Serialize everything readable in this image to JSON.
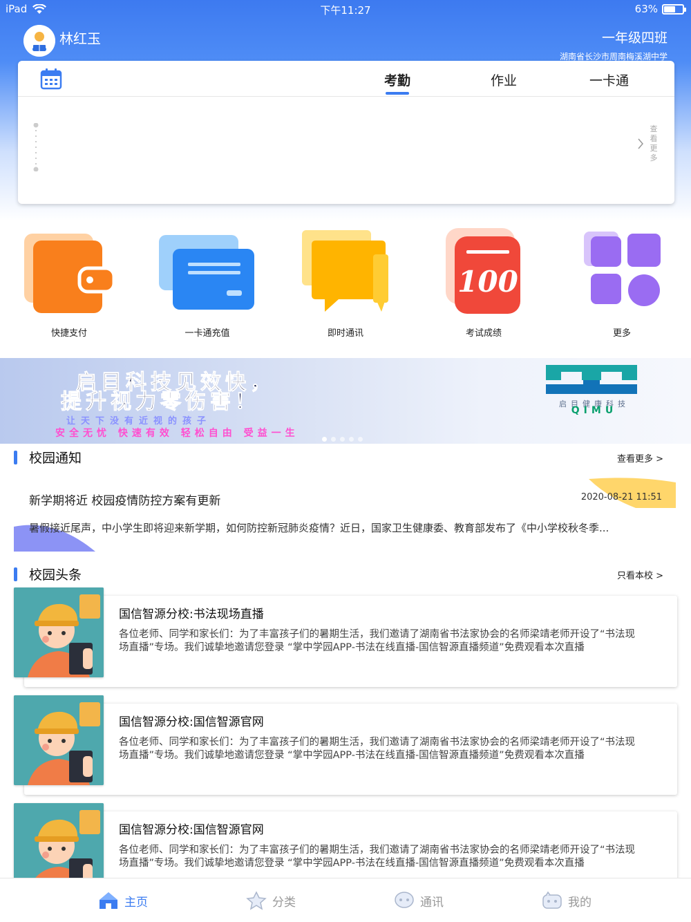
{
  "status_bar": {
    "device": "iPad",
    "time": "下午11:27",
    "battery": "63%",
    "battery_level": 0.63
  },
  "user": {
    "name": "林红玉"
  },
  "class_info": {
    "grade": "一年级四班",
    "school": "湖南省长沙市周南梅溪湖中学"
  },
  "top_tabs": [
    {
      "label": "考勤",
      "active": true
    },
    {
      "label": "作业",
      "active": false
    },
    {
      "label": "一卡通",
      "active": false
    }
  ],
  "attendance": {
    "see_more": "查看更多"
  },
  "quick_icons": [
    {
      "label": "快捷支付",
      "icon": "wallet-icon",
      "color": "#f97f1c"
    },
    {
      "label": "一卡通充值",
      "icon": "card-icon",
      "color": "#2a86f3"
    },
    {
      "label": "即时通讯",
      "icon": "chat-icon",
      "color": "#ffb400"
    },
    {
      "label": "考试成绩",
      "icon": "score-100-icon",
      "color": "#f0483a"
    },
    {
      "label": "更多",
      "icon": "more-grid-icon",
      "color": "#9a6cf2"
    }
  ],
  "banner": {
    "line1": "启目科技见效快，",
    "line2": "提升视力零伤害！",
    "line3": "让天下没有近视的孩子",
    "line4": "安全无忧 快速有效 轻松自由 受益一生",
    "logo_cn": "启目健康科技",
    "logo_en": "QIMU"
  },
  "campus_notice": {
    "title": "校园通知",
    "more": "查看更多 >",
    "item": {
      "title": "新学期将近 校园疫情防控方案有更新",
      "date": "2020-08-21 11:51",
      "body": "暑假接近尾声，中小学生即将迎来新学期，如何防控新冠肺炎疫情？近日，国家卫生健康委、教育部发布了《中小学校秋冬季..."
    }
  },
  "campus_headlines": {
    "title": "校园头条",
    "more": "只看本校 >",
    "items": [
      {
        "title": "国信智源分校:书法现场直播",
        "body": "各位老师、同学和家长们：为了丰富孩子们的暑期生活，我们邀请了湖南省书法家协会的名师梁靖老师开设了“书法现场直播”专场。我们诚挚地邀请您登录 “掌中学园APP-书法在线直播-国信智源直播频道”免费观看本次直播"
      },
      {
        "title": "国信智源分校:国信智源官网",
        "body": "各位老师、同学和家长们：为了丰富孩子们的暑期生活，我们邀请了湖南省书法家协会的名师梁靖老师开设了“书法现场直播”专场。我们诚挚地邀请您登录 “掌中学园APP-书法在线直播-国信智源直播频道”免费观看本次直播"
      },
      {
        "title": "国信智源分校:国信智源官网",
        "body": "各位老师、同学和家长们：为了丰富孩子们的暑期生活，我们邀请了湖南省书法家协会的名师梁靖老师开设了“书法现场直播”专场。我们诚挚地邀请您登录 “掌中学园APP-书法在线直播-国信智源直播频道”免费观看本次直播"
      }
    ]
  },
  "tab_bar": [
    {
      "label": "主页",
      "icon": "home-icon",
      "active": true
    },
    {
      "label": "分类",
      "icon": "category-icon",
      "active": false
    },
    {
      "label": "通讯",
      "icon": "message-icon",
      "active": false
    },
    {
      "label": "我的",
      "icon": "profile-icon",
      "active": false
    }
  ]
}
